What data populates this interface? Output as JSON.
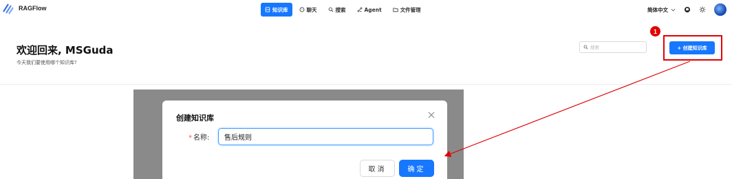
{
  "app": {
    "name": "RAGFlow"
  },
  "nav": {
    "tabs": [
      {
        "label": "知识库",
        "icon": "database-icon",
        "active": true
      },
      {
        "label": "聊天",
        "icon": "chat-icon",
        "active": false
      },
      {
        "label": "搜索",
        "icon": "search-icon",
        "active": false
      },
      {
        "label": "Agent",
        "icon": "agent-icon",
        "active": false
      },
      {
        "label": "文件管理",
        "icon": "folder-icon",
        "active": false
      }
    ]
  },
  "toolbar": {
    "language": "简体中文"
  },
  "header": {
    "title": "欢迎回来, MSGuda",
    "subtitle": "今天我们要使用哪个知识库?"
  },
  "search": {
    "placeholder": "搜索"
  },
  "create_button": {
    "label": "+ 创建知识库"
  },
  "annotation": {
    "step": "1",
    "color": "#e00000"
  },
  "modal": {
    "title": "创建知识库",
    "name_label": "名称:",
    "required_mark": "*",
    "name_value": "售后规则",
    "cancel_label": "取消",
    "ok_label": "确定"
  },
  "colors": {
    "accent": "#1677ff",
    "annotation": "#e00000"
  }
}
